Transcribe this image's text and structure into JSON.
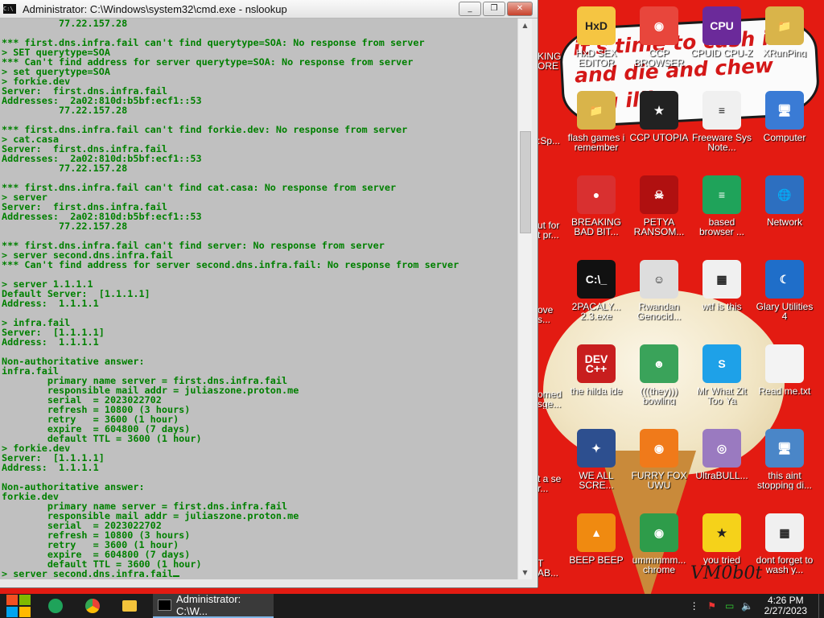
{
  "window": {
    "title": "Administrator: C:\\Windows\\system32\\cmd.exe - nslookup",
    "minimize": "_",
    "maximize": "❐",
    "close": "✕"
  },
  "console_text": "          77.22.157.28\n\n*** first.dns.infra.fail can't find querytype=SOA: No response from server\n> SET querytype=SOA\n*** Can't find address for server querytype=SOA: No response from server\n> set querytype=SOA\n> forkie.dev\nServer:  first.dns.infra.fail\nAddresses:  2a02:810d:b5bf:ecf1::53\n          77.22.157.28\n\n*** first.dns.infra.fail can't find forkie.dev: No response from server\n> cat.casa\nServer:  first.dns.infra.fail\nAddresses:  2a02:810d:b5bf:ecf1::53\n          77.22.157.28\n\n*** first.dns.infra.fail can't find cat.casa: No response from server\n> server\nServer:  first.dns.infra.fail\nAddresses:  2a02:810d:b5bf:ecf1::53\n          77.22.157.28\n\n*** first.dns.infra.fail can't find server: No response from server\n> server second.dns.infra.fail\n*** Can't find address for server second.dns.infra.fail: No response from server\n\n> server 1.1.1.1\nDefault Server:  [1.1.1.1]\nAddress:  1.1.1.1\n\n> infra.fail\nServer:  [1.1.1.1]\nAddress:  1.1.1.1\n\nNon-authoritative answer:\ninfra.fail\n        primary name server = first.dns.infra.fail\n        responsible mail addr = juliaszone.proton.me\n        serial  = 2023022702\n        refresh = 10800 (3 hours)\n        retry   = 3600 (1 hour)\n        expire  = 604800 (7 days)\n        default TTL = 3600 (1 hour)\n> forkie.dev\nServer:  [1.1.1.1]\nAddress:  1.1.1.1\n\nNon-authoritative answer:\nforkie.dev\n        primary name server = first.dns.infra.fail\n        responsible mail addr = juliaszone.proton.me\n        serial  = 2023022702\n        refresh = 10800 (3 hours)\n        retry   = 3600 (1 hour)\n        expire  = 604800 (7 days)\n        default TTL = 3600 (1 hour)\n> server second.dns.infra.fail",
  "wallpaper": {
    "text": "it's time to cash in and die and chew ling illin",
    "signature": "VM0b0t"
  },
  "desktop_icons": [
    {
      "name": "hxd-icon",
      "label": "HxD SEX EDITOR",
      "glyph": "HxD",
      "color": "#f5c542"
    },
    {
      "name": "ccp-browser-icon",
      "label": "CCP BROWSER",
      "glyph": "◉",
      "color": "#e8463c"
    },
    {
      "name": "cpuz-icon",
      "label": "CPUID CPU-Z",
      "glyph": "CPU",
      "color": "#6b2a9a"
    },
    {
      "name": "xrunping-icon",
      "label": "XRunPing",
      "glyph": "📁",
      "color": "#d9b44a"
    },
    {
      "name": "flash-games-icon",
      "label": "flash games i remember",
      "glyph": "📁",
      "color": "#d9b44a"
    },
    {
      "name": "ccp-utopia-icon",
      "label": "CCP UTOPIA",
      "glyph": "★",
      "color": "#222222"
    },
    {
      "name": "freeware-notes-icon",
      "label": "Freeware Sys Note...",
      "glyph": "≡",
      "color": "#f0f0f0"
    },
    {
      "name": "computer-icon",
      "label": "Computer",
      "glyph": "🖥",
      "color": "#3a7bd5"
    },
    {
      "name": "angry-birds-icon",
      "label": "BREAKING BAD BIT...",
      "glyph": "●",
      "color": "#d93030"
    },
    {
      "name": "petya-icon",
      "label": "PETYA RANSOM...",
      "glyph": "☠",
      "color": "#b01010"
    },
    {
      "name": "based-browser-icon",
      "label": "based browser ...",
      "glyph": "≡",
      "color": "#1fa35a"
    },
    {
      "name": "network-icon",
      "label": "Network",
      "glyph": "🌐",
      "color": "#2d6fc0"
    },
    {
      "name": "2pacaly-icon",
      "label": "2PACALY... 2.3.exe",
      "glyph": "C:\\_",
      "color": "#111111"
    },
    {
      "name": "rwandan-icon",
      "label": "Rwandan Genocid...",
      "glyph": "☺",
      "color": "#dddddd"
    },
    {
      "name": "wtf-icon",
      "label": "wtf is this",
      "glyph": "▦",
      "color": "#f0f0f0"
    },
    {
      "name": "glary-icon",
      "label": "Glary Utilities 4",
      "glyph": "☾",
      "color": "#1f6ec9"
    },
    {
      "name": "devcpp-icon",
      "label": "the hilda ide",
      "glyph": "DEV C++",
      "color": "#c81e1e"
    },
    {
      "name": "bowling-icon",
      "label": "(((they))) bowling",
      "glyph": "☻",
      "color": "#3aa35a"
    },
    {
      "name": "skype-icon",
      "label": "Mr What Zit Too Ya",
      "glyph": "S",
      "color": "#1ea1e8"
    },
    {
      "name": "readme-icon",
      "label": "Read me.txt",
      "glyph": "",
      "color": "#f3f3f3"
    },
    {
      "name": "we-all-scream-icon",
      "label": "WE ALL SCRE...",
      "glyph": "✦",
      "color": "#2d4f8f"
    },
    {
      "name": "firefox-icon",
      "label": "FURRY FOX UWU",
      "glyph": "◉",
      "color": "#f07a1a"
    },
    {
      "name": "ultrabull-icon",
      "label": "UltraBULL...",
      "glyph": "◎",
      "color": "#9a7ac0"
    },
    {
      "name": "this-aint-icon",
      "label": "this aint stopping di...",
      "glyph": "🖥",
      "color": "#4a86c8"
    },
    {
      "name": "vlc-icon",
      "label": "BEEP BEEP",
      "glyph": "▲",
      "color": "#f08a10"
    },
    {
      "name": "chrome-icon",
      "label": "ummmmm... chrome",
      "glyph": "◉",
      "color": "#2e9c4a"
    },
    {
      "name": "you-tried-icon",
      "label": "you tried",
      "glyph": "★",
      "color": "#f5d21a"
    },
    {
      "name": "wash-icon",
      "label": "dont forget to wash y...",
      "glyph": "▦",
      "color": "#f0f0f0"
    }
  ],
  "partial_icons": [
    {
      "name": "partial-icon-1",
      "label": "KING ORE"
    },
    {
      "name": "partial-icon-2",
      "label": ":Sp..."
    },
    {
      "name": "partial-icon-3",
      "label": "ut for t pr..."
    },
    {
      "name": "partial-icon-4",
      "label": "ove s..."
    },
    {
      "name": "partial-icon-5",
      "label": "omed sge..."
    },
    {
      "name": "partial-icon-6",
      "label": "t a se r..."
    },
    {
      "name": "partial-icon-7",
      "label": "T AB..."
    }
  ],
  "taskbar": {
    "task_label": "Administrator: C:\\W...",
    "time": "4:26 PM",
    "date": "2/27/2023"
  },
  "colors": {
    "console_bg": "#c0c0c0",
    "console_fg": "#008000",
    "wallpaper_red": "#e31b12",
    "taskbar": "#1c1c1c"
  }
}
